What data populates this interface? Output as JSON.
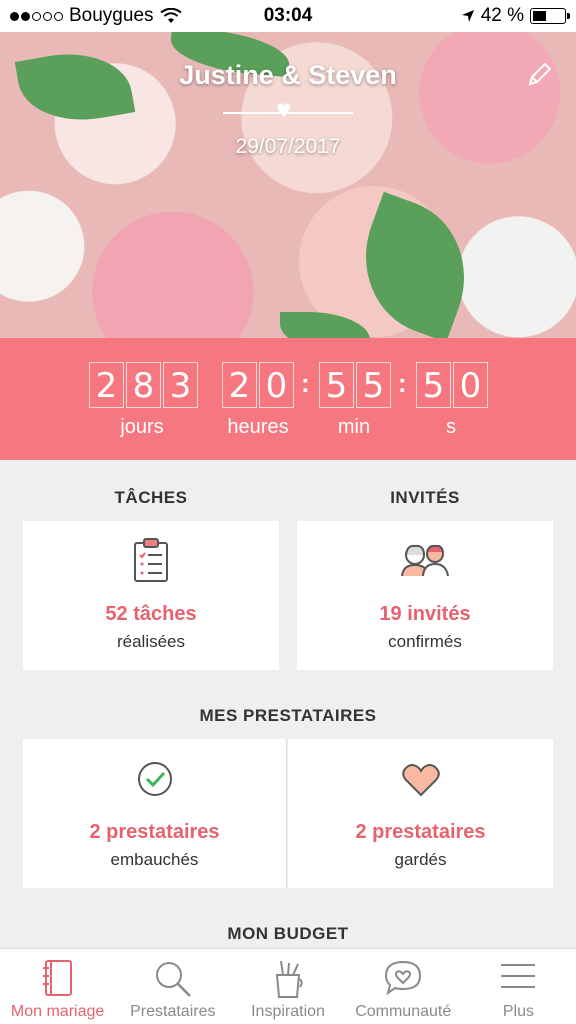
{
  "status_bar": {
    "carrier": "Bouygues",
    "time": "03:04",
    "battery": "42 %",
    "battery_level": 0.42
  },
  "hero": {
    "couple": "Justine & Steven",
    "date": "29/07/2017"
  },
  "countdown": {
    "digits": [
      "2",
      "8",
      "3",
      "2",
      "0",
      "5",
      "5",
      "5",
      "0"
    ],
    "labels": {
      "days": "jours",
      "hours": "heures",
      "minutes": "min",
      "seconds": "s"
    }
  },
  "tasks": {
    "title": "TÂCHES",
    "count": "52 tâches",
    "sub": "réalisées"
  },
  "guests": {
    "title": "INVITÉS",
    "count": "19 invités",
    "sub": "confirmés"
  },
  "vendors": {
    "title": "MES PRESTATAIRES",
    "hired_count": "2 prestataires",
    "hired_sub": "embauchés",
    "saved_count": "2 prestataires",
    "saved_sub": "gardés"
  },
  "budget": {
    "title": "MON BUDGET"
  },
  "tabs": [
    {
      "label": "Mon mariage",
      "icon": "notebook-icon",
      "active": true
    },
    {
      "label": "Prestataires",
      "icon": "search-icon",
      "active": false
    },
    {
      "label": "Inspiration",
      "icon": "pencil-cup-icon",
      "active": false
    },
    {
      "label": "Communauté",
      "icon": "heart-chat-icon",
      "active": false
    },
    {
      "label": "Plus",
      "icon": "menu-icon",
      "active": false
    }
  ],
  "colors": {
    "accent": "#f5777f",
    "accent_text": "#e5636d",
    "heart_fill": "#f8b9a3",
    "check": "#3bb55a"
  }
}
